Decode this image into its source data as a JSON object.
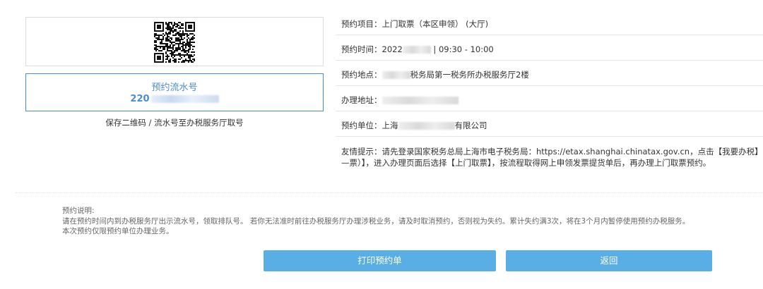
{
  "qr": {
    "icon": "qr-code-icon"
  },
  "serial": {
    "label": "预约流水号",
    "value_prefix": "220"
  },
  "save_hint": "保存二维码 / 流水号至办税服务厅取号",
  "info": {
    "project": "预约项目：上门取票（本区申领）  (大厅)",
    "time_label": "预约时间：",
    "time_prefix": "2022",
    "time_suffix": " | 09:30 - 10:00",
    "place_label": "预约地点：",
    "place_suffix": "税务局第一税务所办税服务厅2楼",
    "address_label": "办理地址：",
    "unit_label": "预约单位：",
    "unit_prefix": "上海",
    "unit_suffix": "有限公司",
    "tip": "友情提示：请先登录国家税务总局上海市电子税务局：https://etax.shanghai.chinatax.gov.cn，点击【我要办税】—票）】，进入办理页面后选择【上门取票】，按流程取得网上申领发票提货单后，再办理上门取票预约。"
  },
  "notes": {
    "title": "预约说明:",
    "line1": "请在预约时间内到办税服务厅出示流水号，领取排队号。 若你无法准时前往办税服务厅办理涉税业务，请及时取消预约，否则视为失约。累计失约满3次，将在3个月内暂停使用预约办税服务。",
    "line2": "本次预约仅限预约单位办理业务。"
  },
  "buttons": {
    "print": "打印预约单",
    "back": "返回"
  },
  "colors": {
    "accent": "#4a8cd0",
    "button": "#5aaee6"
  }
}
